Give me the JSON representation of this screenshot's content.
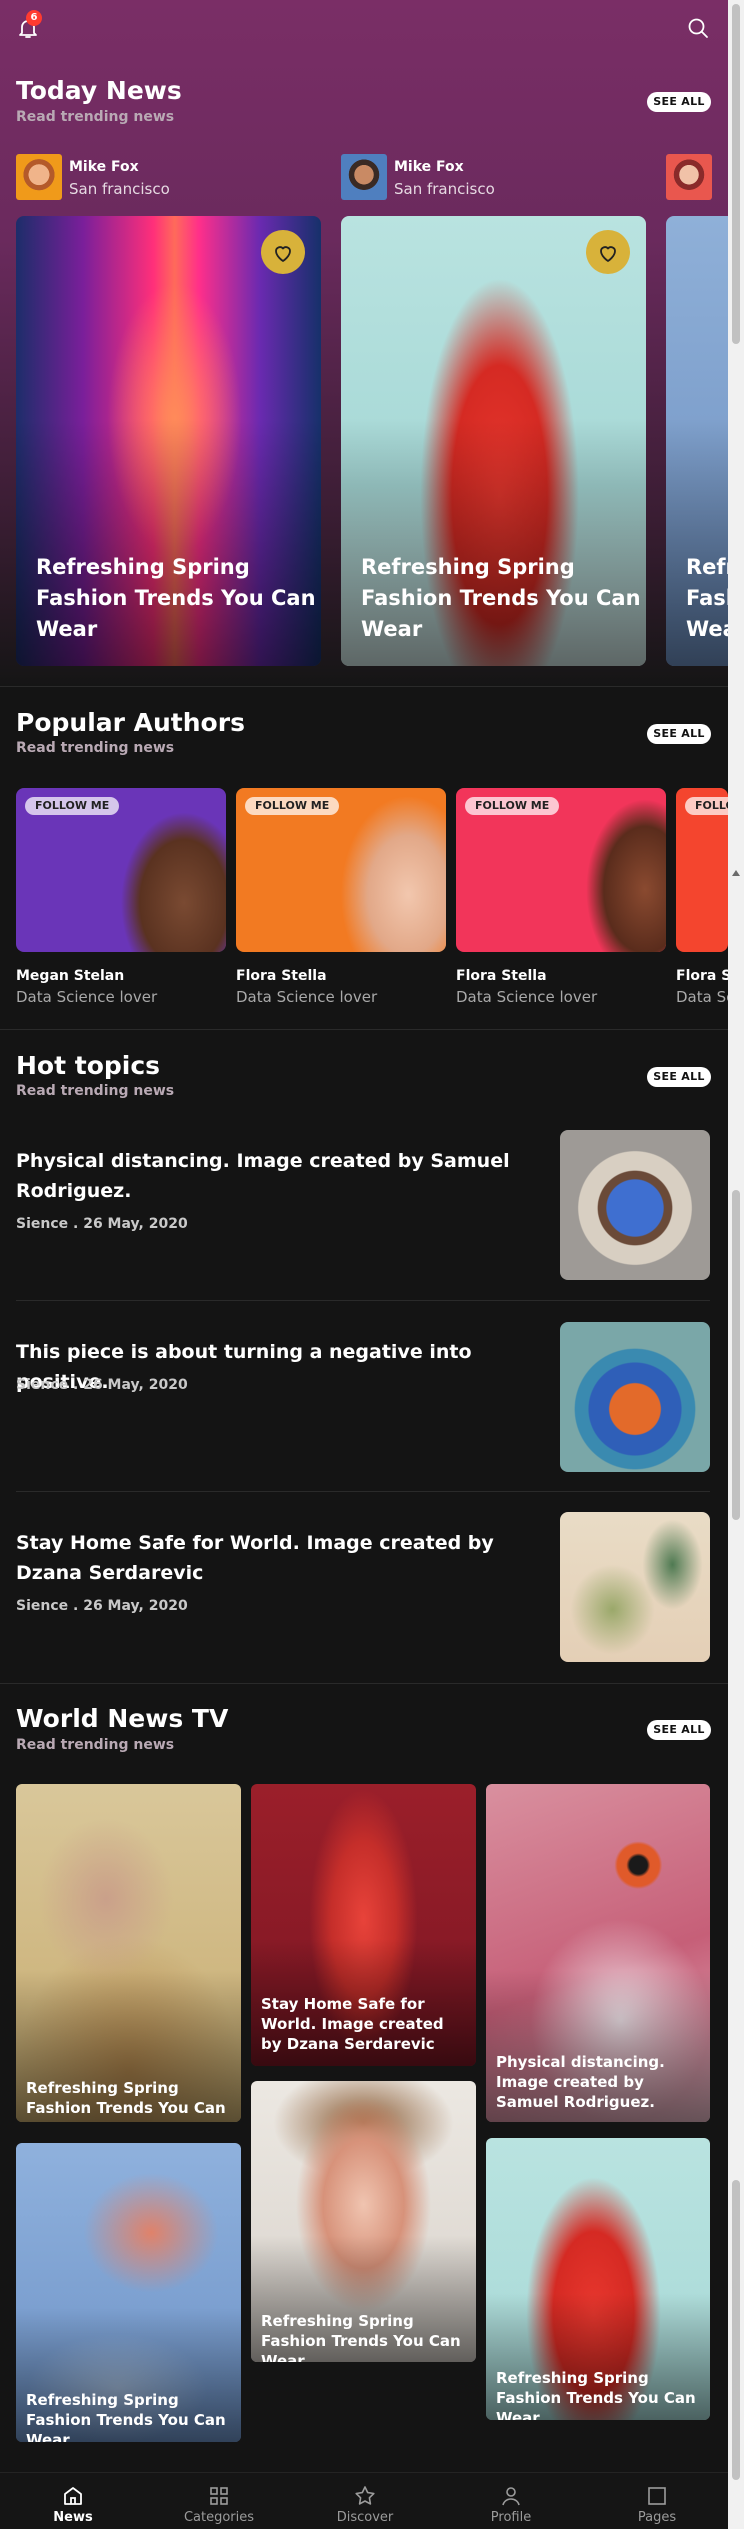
{
  "notifications": {
    "count": "6"
  },
  "today_news": {
    "title": "Today News",
    "subtitle": "Read trending news",
    "see_all": "SEE ALL",
    "authors": [
      {
        "name": "Mike Fox",
        "city": "San francisco"
      },
      {
        "name": "Mike Fox",
        "city": "San francisco"
      }
    ],
    "cards": [
      {
        "title": "Refreshing Spring Fashion Trends You Can Wear"
      },
      {
        "title": "Refreshing Spring Fashion Trends You Can Wear"
      },
      {
        "title": "Refreshing Spring Fashion Trends You Can Wear"
      }
    ]
  },
  "popular_authors": {
    "title": "Popular Authors",
    "subtitle": "Read trending news",
    "see_all": "SEE ALL",
    "follow_label": "FOLLOW ME",
    "items": [
      {
        "name": "Megan Stelan",
        "role": "Data Science lover",
        "color": "#6a35b8"
      },
      {
        "name": "Flora Stella",
        "role": "Data Science lover",
        "color": "#f27a22"
      },
      {
        "name": "Flora Stella",
        "role": "Data Science lover",
        "color": "#f2355a"
      },
      {
        "name": "Flora Stella",
        "role": "Data Science lover",
        "color": "#f4452e"
      }
    ]
  },
  "hot_topics": {
    "title": "Hot topics",
    "subtitle": "Read trending news",
    "see_all": "SEE ALL",
    "items": [
      {
        "title": "Physical distancing. Image created by Samuel Rodriguez.",
        "meta": "Sience . 26 May, 2020"
      },
      {
        "title": "This piece is about turning a negative into positive.",
        "meta": "Sience . 26 May, 2020"
      },
      {
        "title": "Stay Home Safe for World. Image created by Dzana Serdarevic",
        "meta": "Sience . 26 May, 2020"
      }
    ]
  },
  "world_news_tv": {
    "title": "World News TV",
    "subtitle": "Read trending news",
    "see_all": "SEE ALL",
    "items": [
      {
        "caption": "Refreshing Spring Fashion Trends You Can Wear"
      },
      {
        "caption": "Stay Home Safe for World. Image created by Dzana Serdarevic"
      },
      {
        "caption": "Physical distancing. Image created by Samuel Rodriguez."
      },
      {
        "caption": "Refreshing Spring Fashion Trends You Can Wear"
      },
      {
        "caption": "Refreshing Spring Fashion Trends You Can Wear"
      },
      {
        "caption": "Refreshing Spring Fashion Trends You Can Wear"
      }
    ]
  },
  "tabbar": {
    "active": "News",
    "items": [
      {
        "label": "News",
        "icon": "home-icon"
      },
      {
        "label": "Categories",
        "icon": "grid-icon"
      },
      {
        "label": "Discover",
        "icon": "star-icon"
      },
      {
        "label": "Profile",
        "icon": "user-icon"
      },
      {
        "label": "Pages",
        "icon": "square-icon"
      }
    ]
  },
  "colors": {
    "accent": "#d8b23a",
    "header": "#7a2e66",
    "background": "#141414"
  }
}
